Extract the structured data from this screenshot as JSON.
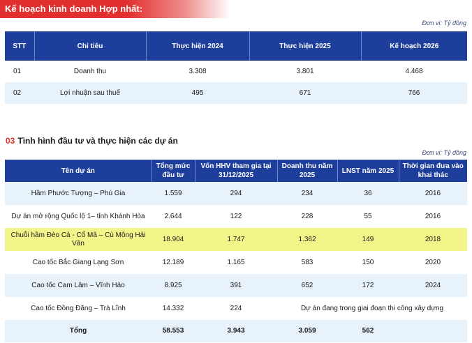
{
  "banner": {
    "title": "Kế hoạch kinh doanh Hợp nhất:"
  },
  "unit1": "Đơn vị: Tỷ đồng",
  "table1": {
    "headers": [
      "STT",
      "Chỉ tiêu",
      "Thực hiện 2024",
      "Thực hiện 2025",
      "Kế hoạch 2026"
    ],
    "rows": [
      [
        "01",
        "Doanh thu",
        "3.308",
        "3.801",
        "4.468"
      ],
      [
        "02",
        "Lợi nhuận sau thuế",
        "495",
        "671",
        "766"
      ]
    ]
  },
  "section": {
    "number": "03",
    "title": "Tình hình đầu tư và thực hiện các dự án"
  },
  "unit2": "Đơn vị: Tỷ đồng",
  "table2": {
    "headers": [
      "Tên dự án",
      "Tổng mức đầu tư",
      "Vốn HHV tham gia tại 31/12/2025",
      "Doanh thu năm 2025",
      "LNST năm 2025",
      "Thời gian đưa vào khai thác"
    ],
    "rows": [
      [
        "Hầm Phước Tượng – Phú Gia",
        "1.559",
        "294",
        "234",
        "36",
        "2016"
      ],
      [
        "Dự án mở rộng Quốc lộ 1– tỉnh Khánh Hòa",
        "2.644",
        "122",
        "228",
        "55",
        "2016"
      ],
      [
        "Chuỗi hầm Đèo Cả - Cổ Mã – Cù Mông Hải Vân",
        "18.904",
        "1.747",
        "1.362",
        "149",
        "2018"
      ],
      [
        "Cao tốc Bắc Giang Lạng Sơn",
        "12.189",
        "1.165",
        "583",
        "150",
        "2020"
      ],
      [
        "Cao tốc Cam Lâm – Vĩnh Hảo",
        "8.925",
        "391",
        "652",
        "172",
        "2024"
      ]
    ],
    "last_row": {
      "name": "Cao tốc Đồng Đăng – Trà Lĩnh",
      "total": "14.332",
      "capital": "224",
      "note": "Dự án đang trong giai đoạn thi công xây dựng"
    },
    "total_row": [
      "Tổng",
      "58.553",
      "3.943",
      "3.059",
      "562",
      ""
    ]
  },
  "colors": {
    "header": "#1e3e9c",
    "accent": "#e2302f",
    "alt_row": "#e8f2fa",
    "highlight": "#f2f68a"
  }
}
